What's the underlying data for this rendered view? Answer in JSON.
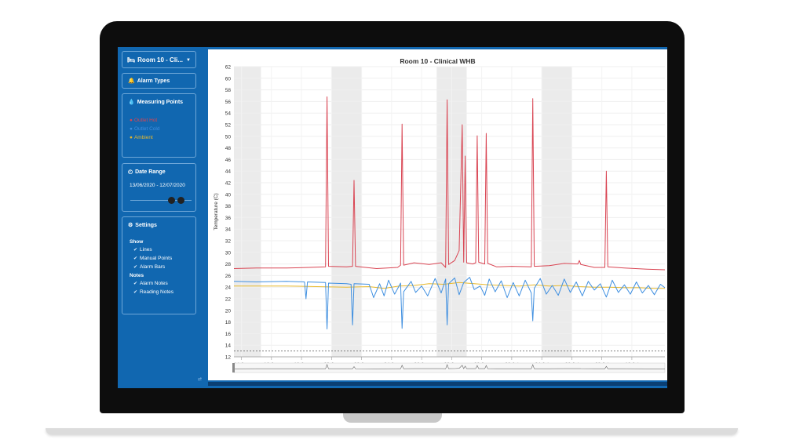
{
  "room_select": {
    "label": "Room 10 - Cli...",
    "icon": "bed-icon"
  },
  "alarm_types": {
    "label": "Alarm Types",
    "icon": "bell-icon"
  },
  "measuring_points": {
    "label": "Measuring Points",
    "icon": "droplet-icon",
    "items": [
      {
        "label": "Outlet Hot",
        "color": "#d94452"
      },
      {
        "label": "Outlet Cold",
        "color": "#3f8fe0"
      },
      {
        "label": "Ambient",
        "color": "#e8b92c"
      }
    ]
  },
  "date_range": {
    "label": "Date Range",
    "icon": "clock-icon",
    "value": "13/06/2020 - 12/07/2020"
  },
  "settings": {
    "label": "Settings",
    "icon": "gear-icon",
    "show_label": "Show",
    "show_items": [
      "Lines",
      "Manual Points",
      "Alarm Bars"
    ],
    "notes_label": "Notes",
    "notes_items": [
      "Alarm Notes",
      "Reading Notes"
    ]
  },
  "resize_handle": "⇄",
  "chart_data": {
    "type": "line",
    "title": "Room 10 - Clinical WHB",
    "ylabel": "Temperature (C)",
    "xlabel": "",
    "ylim": [
      12,
      62
    ],
    "yticks": [
      12,
      14,
      16,
      18,
      20,
      22,
      24,
      26,
      28,
      30,
      32,
      34,
      36,
      38,
      40,
      42,
      44,
      46,
      48,
      50,
      52,
      54,
      56,
      58,
      60,
      62
    ],
    "xlim": [
      13.5,
      42.2
    ],
    "xticks": [
      {
        "day": 14,
        "label": "14 Jun"
      },
      {
        "day": 16,
        "label": "16 Jun"
      },
      {
        "day": 18,
        "label": "18 Jun"
      },
      {
        "day": 20,
        "label": "20 Jun"
      },
      {
        "day": 22,
        "label": "22 Jun"
      },
      {
        "day": 24,
        "label": "24 Jun"
      },
      {
        "day": 26,
        "label": "26 Jun"
      },
      {
        "day": 28,
        "label": "28 Jun"
      },
      {
        "day": 30,
        "label": "30 Jun"
      },
      {
        "day": 32,
        "label": "02 Jul"
      },
      {
        "day": 34,
        "label": "04 Jul"
      },
      {
        "day": 36,
        "label": "06 Jul"
      },
      {
        "day": 38,
        "label": "08 Jul"
      },
      {
        "day": 40,
        "label": "10 Jul"
      }
    ],
    "weekend_bands": [
      [
        13.5,
        15.3
      ],
      [
        20.0,
        22.0
      ],
      [
        27.0,
        29.0
      ],
      [
        34.0,
        36.0
      ]
    ],
    "threshold_line": 13,
    "series": [
      {
        "name": "Outlet Hot",
        "color": "#d94452",
        "points": [
          [
            13.5,
            27.2
          ],
          [
            15,
            27.3
          ],
          [
            17,
            27.3
          ],
          [
            18.5,
            27.4
          ],
          [
            19.6,
            27.5
          ],
          [
            19.7,
            56.8
          ],
          [
            19.8,
            27.6
          ],
          [
            21,
            27.5
          ],
          [
            21.4,
            27.6
          ],
          [
            21.5,
            42.4
          ],
          [
            21.6,
            27.6
          ],
          [
            23,
            27.2
          ],
          [
            24.4,
            27.4
          ],
          [
            24.6,
            27.8
          ],
          [
            24.7,
            52.1
          ],
          [
            24.8,
            27.8
          ],
          [
            25.5,
            28.2
          ],
          [
            26.5,
            27.9
          ],
          [
            27.3,
            28.2
          ],
          [
            27.6,
            27.4
          ],
          [
            27.7,
            56.3
          ],
          [
            27.8,
            27.9
          ],
          [
            28.2,
            28.6
          ],
          [
            28.5,
            30.3
          ],
          [
            28.7,
            52.0
          ],
          [
            28.8,
            28.3
          ],
          [
            28.9,
            46.6
          ],
          [
            29.0,
            28.2
          ],
          [
            29.4,
            28.0
          ],
          [
            29.6,
            28.2
          ],
          [
            29.7,
            50.1
          ],
          [
            29.8,
            28.3
          ],
          [
            30.2,
            28.0
          ],
          [
            30.3,
            50.5
          ],
          [
            30.4,
            28.1
          ],
          [
            31,
            27.5
          ],
          [
            32,
            27.6
          ],
          [
            33.3,
            27.5
          ],
          [
            33.4,
            56.5
          ],
          [
            33.5,
            27.6
          ],
          [
            34.5,
            27.7
          ],
          [
            35.5,
            28.1
          ],
          [
            36.4,
            28.0
          ],
          [
            36.5,
            28.6
          ],
          [
            36.6,
            27.9
          ],
          [
            37.5,
            27.4
          ],
          [
            38.2,
            27.4
          ],
          [
            38.3,
            44.0
          ],
          [
            38.4,
            27.5
          ],
          [
            39.5,
            27.3
          ],
          [
            41,
            27.1
          ],
          [
            42.2,
            27.0
          ]
        ]
      },
      {
        "name": "Outlet Cold",
        "color": "#3f8fe0",
        "points": [
          [
            13.5,
            25.0
          ],
          [
            15,
            24.9
          ],
          [
            17,
            25.0
          ],
          [
            18.2,
            24.9
          ],
          [
            18.3,
            22.0
          ],
          [
            18.4,
            24.9
          ],
          [
            19.6,
            24.8
          ],
          [
            19.7,
            16.8
          ],
          [
            19.8,
            24.7
          ],
          [
            21,
            24.6
          ],
          [
            21.3,
            24.5
          ],
          [
            21.4,
            17.5
          ],
          [
            21.5,
            24.6
          ],
          [
            22.5,
            24.5
          ],
          [
            22.7,
            23.0
          ],
          [
            22.8,
            22.2
          ],
          [
            23.2,
            24.6
          ],
          [
            23.5,
            22.5
          ],
          [
            23.8,
            25.2
          ],
          [
            24.2,
            22.8
          ],
          [
            24.6,
            24.7
          ],
          [
            24.7,
            16.9
          ],
          [
            24.8,
            23.2
          ],
          [
            25.3,
            25.0
          ],
          [
            25.6,
            23.1
          ],
          [
            26.0,
            24.2
          ],
          [
            26.4,
            22.5
          ],
          [
            26.9,
            25.5
          ],
          [
            27.3,
            23.0
          ],
          [
            27.6,
            25.4
          ],
          [
            27.7,
            17.5
          ],
          [
            27.8,
            24.6
          ],
          [
            28.2,
            25.6
          ],
          [
            28.5,
            22.7
          ],
          [
            28.8,
            24.8
          ],
          [
            29.2,
            25.7
          ],
          [
            29.5,
            23.6
          ],
          [
            29.9,
            24.2
          ],
          [
            30.2,
            22.6
          ],
          [
            30.5,
            25.4
          ],
          [
            30.9,
            23.2
          ],
          [
            31.3,
            25.1
          ],
          [
            31.7,
            22.2
          ],
          [
            32.1,
            24.8
          ],
          [
            32.5,
            22.5
          ],
          [
            32.9,
            25.2
          ],
          [
            33.3,
            23.0
          ],
          [
            33.4,
            18.2
          ],
          [
            33.5,
            23.8
          ],
          [
            33.9,
            25.5
          ],
          [
            34.3,
            22.8
          ],
          [
            34.7,
            24.3
          ],
          [
            35.1,
            22.6
          ],
          [
            35.5,
            25.4
          ],
          [
            35.9,
            23.1
          ],
          [
            36.3,
            24.9
          ],
          [
            36.7,
            22.5
          ],
          [
            37.1,
            25.0
          ],
          [
            37.5,
            23.5
          ],
          [
            37.9,
            24.6
          ],
          [
            38.3,
            22.3
          ],
          [
            38.7,
            25.2
          ],
          [
            39.1,
            23.1
          ],
          [
            39.5,
            24.4
          ],
          [
            39.9,
            22.8
          ],
          [
            40.3,
            24.9
          ],
          [
            40.7,
            23.0
          ],
          [
            41.1,
            24.3
          ],
          [
            41.5,
            22.7
          ],
          [
            41.9,
            24.5
          ],
          [
            42.2,
            23.9
          ]
        ]
      },
      {
        "name": "Ambient",
        "color": "#e8b92c",
        "points": [
          [
            13.5,
            24.2
          ],
          [
            15,
            24.2
          ],
          [
            17,
            24.2
          ],
          [
            19,
            24.1
          ],
          [
            21,
            24.0
          ],
          [
            22.5,
            24.1
          ],
          [
            23.5,
            23.8
          ],
          [
            24.5,
            24.2
          ],
          [
            25.5,
            24.3
          ],
          [
            26.5,
            24.6
          ],
          [
            27.5,
            24.5
          ],
          [
            28.5,
            24.8
          ],
          [
            29.5,
            24.6
          ],
          [
            30.5,
            24.4
          ],
          [
            31.5,
            24.3
          ],
          [
            32.5,
            24.2
          ],
          [
            33.5,
            24.4
          ],
          [
            34.5,
            24.2
          ],
          [
            35.5,
            24.3
          ],
          [
            36.5,
            24.1
          ],
          [
            37.5,
            24.0
          ],
          [
            38.5,
            24.0
          ],
          [
            39.5,
            23.9
          ],
          [
            40.5,
            23.9
          ],
          [
            41.5,
            23.8
          ],
          [
            42.2,
            23.8
          ]
        ]
      }
    ],
    "grid": true
  }
}
